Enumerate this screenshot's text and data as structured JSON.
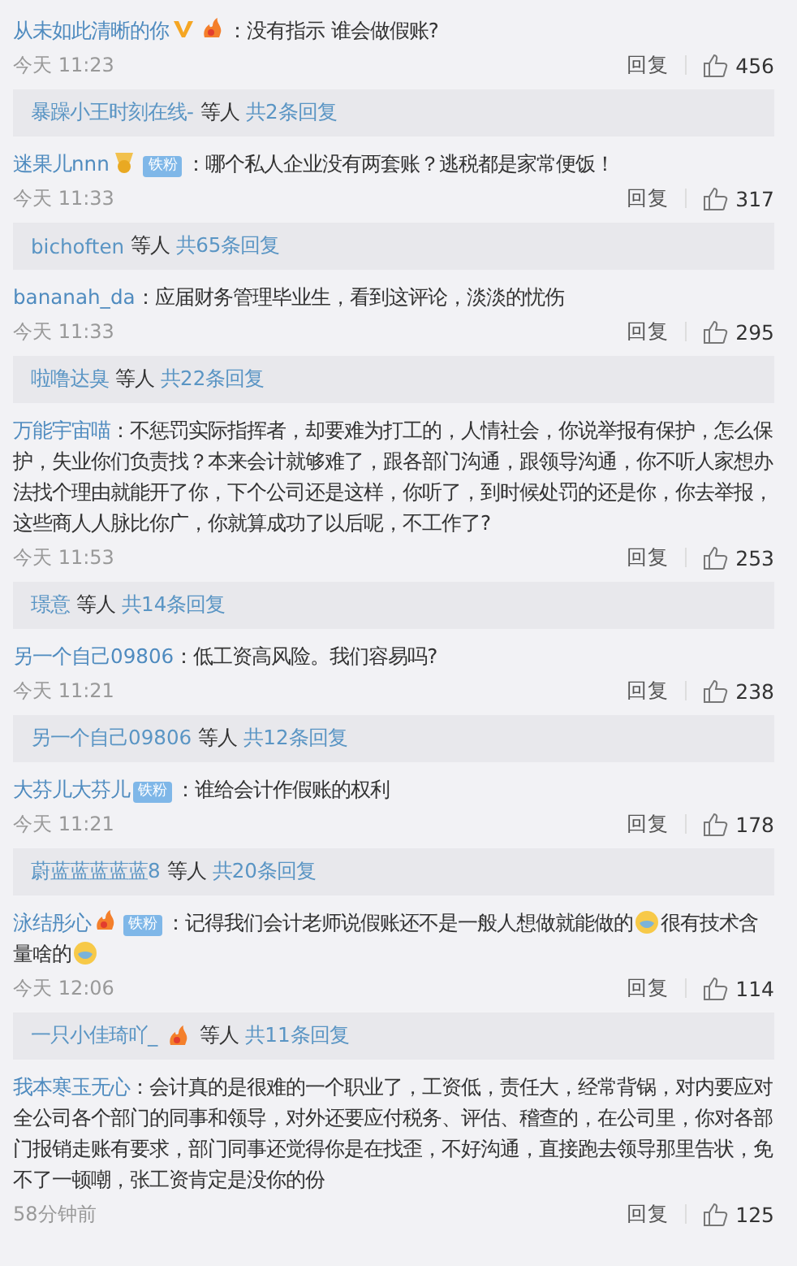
{
  "comments": [
    {
      "author": "从未如此清晰的你",
      "badges": [
        {
          "kind": "vip"
        },
        {
          "kind": "fire"
        }
      ],
      "separator": "：",
      "content": [
        {
          "kind": "text",
          "text": "没有指示 谁会做假账?"
        }
      ],
      "time": "今天 11:23",
      "reply": "回复",
      "likes": "456",
      "thread": {
        "names": "暴躁小王时刻在线-",
        "others": "等人",
        "count": "共2条回复"
      }
    },
    {
      "author": "迷果儿nnn",
      "badges": [
        {
          "kind": "medal"
        },
        {
          "kind": "fan",
          "text": "铁粉"
        }
      ],
      "separator": "：",
      "content": [
        {
          "kind": "text",
          "text": "哪个私人企业没有两套账？逃税都是家常便饭！"
        }
      ],
      "time": "今天 11:33",
      "reply": "回复",
      "likes": "317",
      "thread": {
        "names": "bichoften",
        "others": "等人",
        "count": "共65条回复"
      }
    },
    {
      "author": "bananah_da",
      "separator": "：",
      "content": [
        {
          "kind": "text",
          "text": "应届财务管理毕业生，看到这评论，淡淡的忧伤"
        }
      ],
      "time": "今天 11:33",
      "reply": "回复",
      "likes": "295",
      "thread": {
        "names": "啦噜达臭",
        "others": "等人",
        "count": "共22条回复"
      }
    },
    {
      "author": "万能宇宙喵",
      "separator": "：",
      "content": [
        {
          "kind": "text",
          "text": "不惩罚实际指挥者，却要难为打工的，人情社会，你说举报有保护，怎么保护，失业你们负责找？本来会计就够难了，跟各部门沟通，跟领导沟通，你不听人家想办法找个理由就能开了你，下个公司还是这样，你听了，到时候处罚的还是你，你去举报，这些商人人脉比你广，你就算成功了以后呢，不工作了?"
        }
      ],
      "time": "今天 11:53",
      "reply": "回复",
      "likes": "253",
      "thread": {
        "names": "璟意",
        "others": "等人",
        "count": "共14条回复"
      }
    },
    {
      "author": "另一个自己09806",
      "separator": "：",
      "content": [
        {
          "kind": "text",
          "text": "低工资高风险。我们容易吗?"
        }
      ],
      "time": "今天 11:21",
      "reply": "回复",
      "likes": "238",
      "thread": {
        "names": "另一个自己09806",
        "others": "等人",
        "count": "共12条回复"
      }
    },
    {
      "author": "大芬儿大芬儿",
      "badges": [
        {
          "kind": "fan",
          "text": "铁粉"
        }
      ],
      "separator": "：",
      "content": [
        {
          "kind": "text",
          "text": "谁给会计作假账的权利"
        }
      ],
      "time": "今天 11:21",
      "reply": "回复",
      "likes": "178",
      "thread": {
        "names": "蔚蓝蓝蓝蓝蓝8",
        "others": "等人",
        "count": "共20条回复"
      }
    },
    {
      "author": "泳结彤心",
      "badges": [
        {
          "kind": "fire"
        },
        {
          "kind": "fan",
          "text": "铁粉"
        }
      ],
      "separator": "：",
      "content": [
        {
          "kind": "text",
          "text": "记得我们会计老师说假账还不是一般人想做就能做的"
        },
        {
          "kind": "emoji"
        },
        {
          "kind": "text",
          "text": "很有技术含量啥的"
        },
        {
          "kind": "emoji"
        }
      ],
      "time": "今天 12:06",
      "reply": "回复",
      "likes": "114",
      "thread": {
        "names": "一只小佳琦吖_",
        "badges": [
          {
            "kind": "fire"
          }
        ],
        "others": "等人",
        "count": "共11条回复"
      }
    },
    {
      "author": "我本寒玉无心",
      "separator": "：",
      "content": [
        {
          "kind": "text",
          "text": "会计真的是很难的一个职业了，工资低，责任大，经常背锅，对内要应对全公司各个部门的同事和领导，对外还要应付税务、评估、稽查的，在公司里，你对各部门报销走账有要求，部门同事还觉得你是在找歪，不好沟通，直接跑去领导那里告状，免不了一顿嘲，张工资肯定是没你的份"
        }
      ],
      "time": "58分钟前",
      "reply": "回复",
      "likes": "125"
    }
  ]
}
